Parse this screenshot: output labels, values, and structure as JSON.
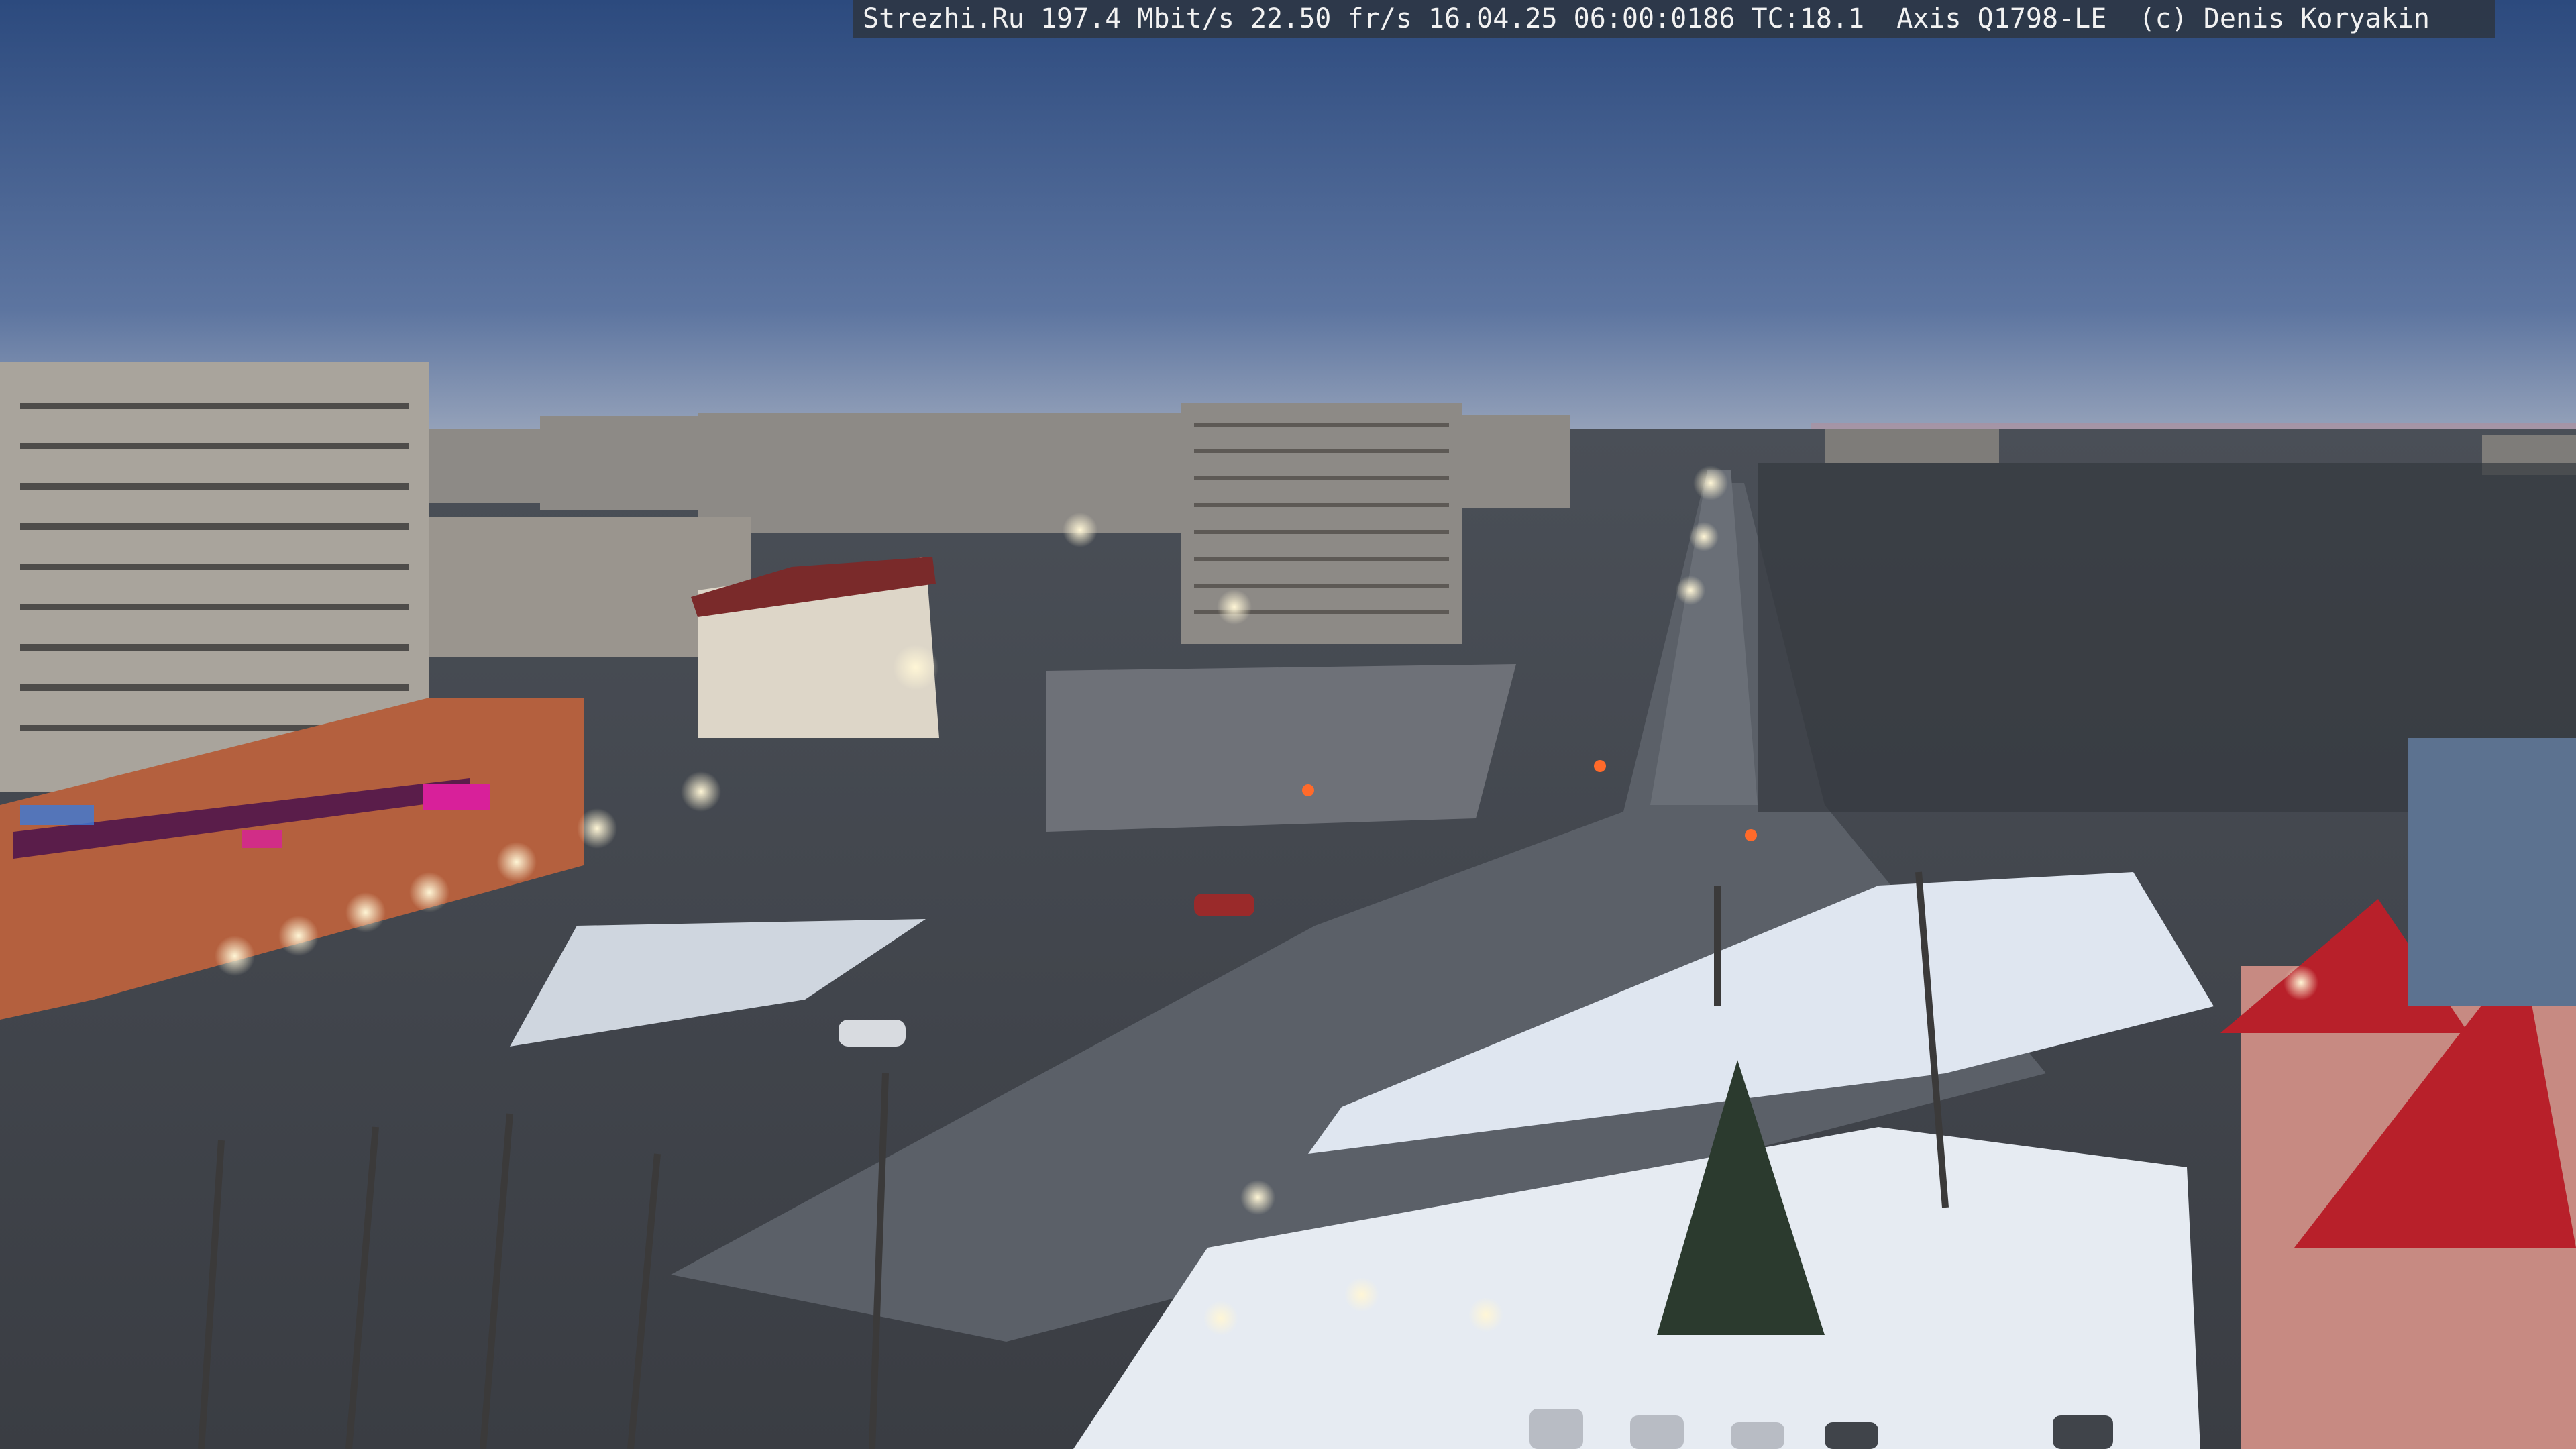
{
  "camera_overlay": {
    "text": "Strezhi.Ru 197.4 Mbit/s 22.50 fr/s 16.04.25 06:00:0186 TC:18.1  Axis Q1798-LE  (c) Denis Koryakin"
  },
  "scene": {
    "sky_top_color": "#2f4d80",
    "sky_horizon_color": "#8a9bb8",
    "road_color": "#5b6068",
    "snow_color": "#dfe6f0",
    "streetlight_color": "#fff1c4",
    "storefront_accent_color": "#d8209a",
    "red_roof_color": "#b8202a"
  }
}
